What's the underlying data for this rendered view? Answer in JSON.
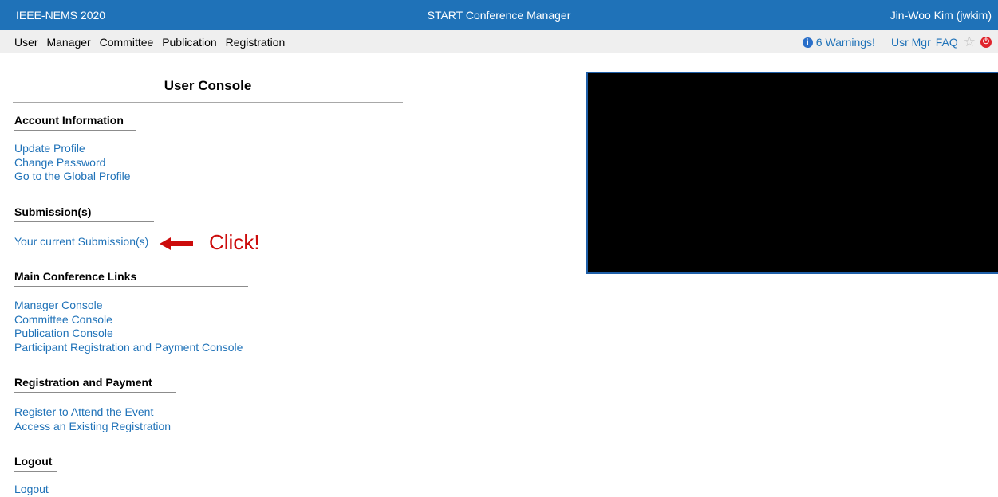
{
  "header": {
    "conference": "IEEE-NEMS 2020",
    "app_title": "START Conference Manager",
    "user": "Jin-Woo Kim (jwkim)"
  },
  "menu": {
    "items": [
      "User",
      "Manager",
      "Committee",
      "Publication",
      "Registration"
    ],
    "warnings": "6 Warnings!",
    "usr_mgr": "Usr Mgr",
    "faq": "FAQ"
  },
  "page": {
    "title": "User Console"
  },
  "sections": [
    {
      "heading": "Account Information",
      "links": [
        "Update Profile",
        "Change Password",
        "Go to the Global Profile"
      ]
    },
    {
      "heading": "Submission(s)",
      "links": [
        "Your current Submission(s)"
      ]
    },
    {
      "heading": "Main Conference Links",
      "links": [
        "Manager Console",
        "Committee Console",
        "Publication Console",
        "Participant Registration and Payment Console"
      ]
    },
    {
      "heading": "Registration and Payment",
      "links": [
        "Register to Attend the Event",
        "Access an Existing Registration"
      ]
    },
    {
      "heading": "Logout",
      "links": [
        "Logout"
      ]
    }
  ],
  "callout": {
    "text": "Click!",
    "color": "#cc0b0b"
  },
  "colors": {
    "accent": "#1f72b8",
    "menubar": "#efefef"
  },
  "icons": [
    "info-icon",
    "star-icon",
    "power-icon",
    "arrow-left-icon"
  ]
}
